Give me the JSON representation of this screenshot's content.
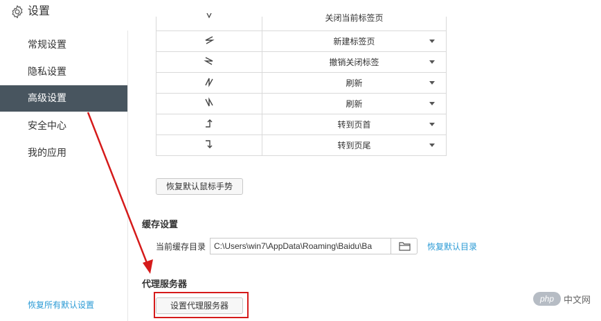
{
  "header": {
    "title": "设置",
    "icon": "gear-icon"
  },
  "sidebar": {
    "items": [
      {
        "label": "常规设置",
        "active": false
      },
      {
        "label": "隐私设置",
        "active": false
      },
      {
        "label": "高级设置",
        "active": true
      },
      {
        "label": "安全中心",
        "active": false
      },
      {
        "label": "我的应用",
        "active": false
      }
    ],
    "restore_all": "恢复所有默认设置"
  },
  "gestures": {
    "rows": [
      {
        "icon": "gesture-partial-icon",
        "action": "关闭当前标签页"
      },
      {
        "icon": "gesture-left-zigzag-icon",
        "action": "新建标签页"
      },
      {
        "icon": "gesture-right-zigzag-icon",
        "action": "撤销关闭标签"
      },
      {
        "icon": "gesture-up-zigzag-icon",
        "action": "刷新"
      },
      {
        "icon": "gesture-down-zigzag-icon",
        "action": "刷新"
      },
      {
        "icon": "gesture-turn-up-icon",
        "action": "转到页首"
      },
      {
        "icon": "gesture-turn-down-icon",
        "action": "转到页尾"
      }
    ],
    "restore_button": "恢复默认鼠标手势"
  },
  "cache": {
    "title": "缓存设置",
    "label": "当前缓存目录",
    "path": "C:\\Users\\win7\\AppData\\Roaming\\Baidu\\Ba",
    "restore_link": "恢复默认目录"
  },
  "proxy": {
    "title": "代理服务器",
    "button": "设置代理服务器"
  },
  "watermark": {
    "logo": "php",
    "text": "中文网"
  },
  "colors": {
    "accent": "#2a9ad5",
    "active_nav": "#48555f",
    "highlight": "#d51a1a"
  }
}
